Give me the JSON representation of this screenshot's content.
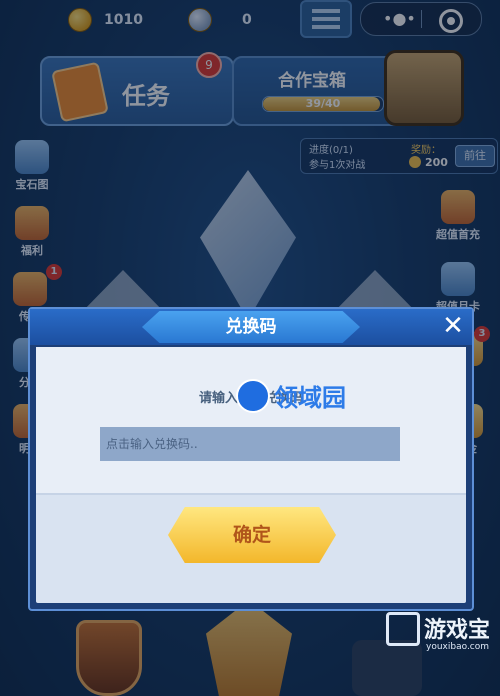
{
  "topbar": {
    "coins": "1010",
    "gems": "0"
  },
  "banners": {
    "task_label": "任务",
    "task_badge": "9",
    "chest_title": "合作宝箱",
    "chest_progress": "39/40",
    "chest_progress_value": 0.975
  },
  "quest": {
    "progress": "进度(0/1)",
    "desc": "参与1次对战",
    "reward_label": "奖励：",
    "reward_value": "200",
    "go_button": "前往"
  },
  "side_menu": {
    "left": [
      {
        "label": "宝石图"
      },
      {
        "label": "福利"
      },
      {
        "label": "传讯",
        "badge": "1"
      },
      {
        "label": "分享"
      },
      {
        "label": "明日"
      }
    ],
    "right": [
      {
        "label": "超值首充"
      },
      {
        "label": "超值月卡"
      },
      {
        "label": "",
        "badge": "3"
      },
      {
        "label": "基金"
      }
    ]
  },
  "modal": {
    "title": "兑换码",
    "close": "✕",
    "prompt": "请输入礼包兑换码",
    "input_placeholder": "点击输入兑换码..",
    "confirm": "确定"
  },
  "overlay_watermark": "领域园",
  "site_watermark": {
    "name": "游戏宝",
    "url": "youxibao.com"
  }
}
